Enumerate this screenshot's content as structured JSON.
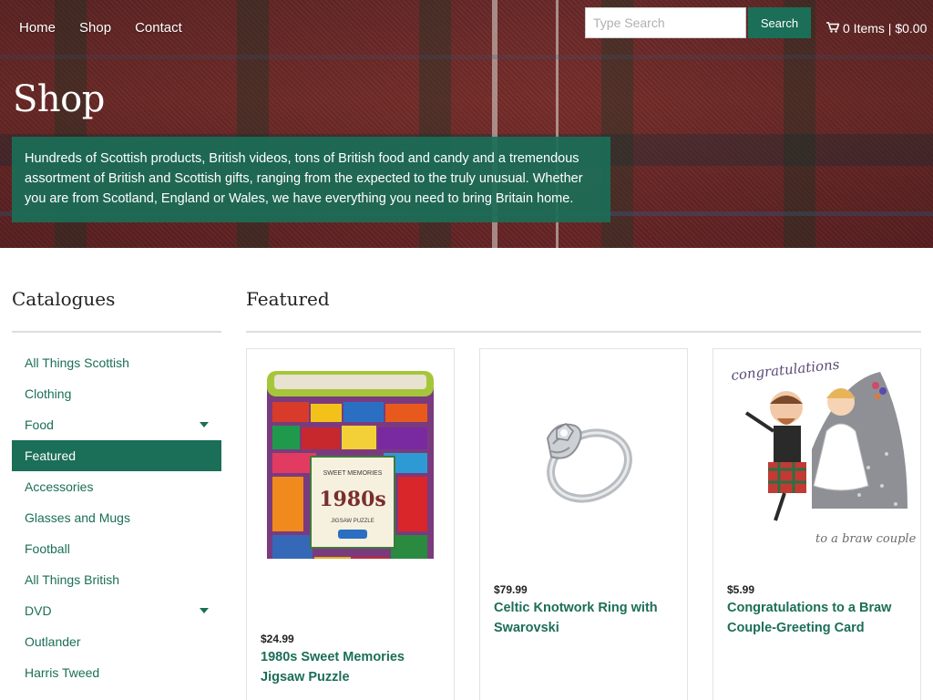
{
  "nav": {
    "items": [
      "Home",
      "Shop",
      "Contact"
    ]
  },
  "search": {
    "placeholder": "Type Search",
    "button_label": "Search"
  },
  "cart": {
    "icon": "cart-icon",
    "summary": "0 Items | $0.00"
  },
  "hero": {
    "title": "Shop",
    "description": "Hundreds of Scottish products, British videos, tons of British food and candy and a tremendous assortment of British and Scottish gifts, ranging from the expected to the truly unusual. Whether you are from Scotland, England or Wales, we have everything you need to bring Britain home."
  },
  "sidebar": {
    "heading": "Catalogues",
    "items": [
      {
        "label": "All Things Scottish",
        "expandable": false,
        "active": false
      },
      {
        "label": "Clothing",
        "expandable": false,
        "active": false
      },
      {
        "label": "Food",
        "expandable": true,
        "active": false
      },
      {
        "label": "Featured",
        "expandable": false,
        "active": true
      },
      {
        "label": "Accessories",
        "expandable": false,
        "active": false
      },
      {
        "label": "Glasses and Mugs",
        "expandable": false,
        "active": false
      },
      {
        "label": "Football",
        "expandable": false,
        "active": false
      },
      {
        "label": "All Things British",
        "expandable": false,
        "active": false
      },
      {
        "label": "DVD",
        "expandable": true,
        "active": false
      },
      {
        "label": "Outlander",
        "expandable": false,
        "active": false
      },
      {
        "label": "Harris Tweed",
        "expandable": false,
        "active": false
      }
    ]
  },
  "main": {
    "heading": "Featured",
    "products": [
      {
        "price": "$24.99",
        "title": "1980s Sweet Memories Jigsaw Puzzle",
        "image_text": [
          "SWEET MEMORIES",
          "1980s",
          "JIGSAW PUZZLE"
        ]
      },
      {
        "price": "$79.99",
        "title": "Celtic Knotwork Ring with Swarovski"
      },
      {
        "price": "$5.99",
        "title": "Congratulations to a Braw Couple-Greeting Card",
        "image_text": [
          "congratulations",
          "to a braw couple"
        ]
      }
    ]
  },
  "colors": {
    "accent": "#1b6e57",
    "hero_base": "#7c2f2c"
  }
}
